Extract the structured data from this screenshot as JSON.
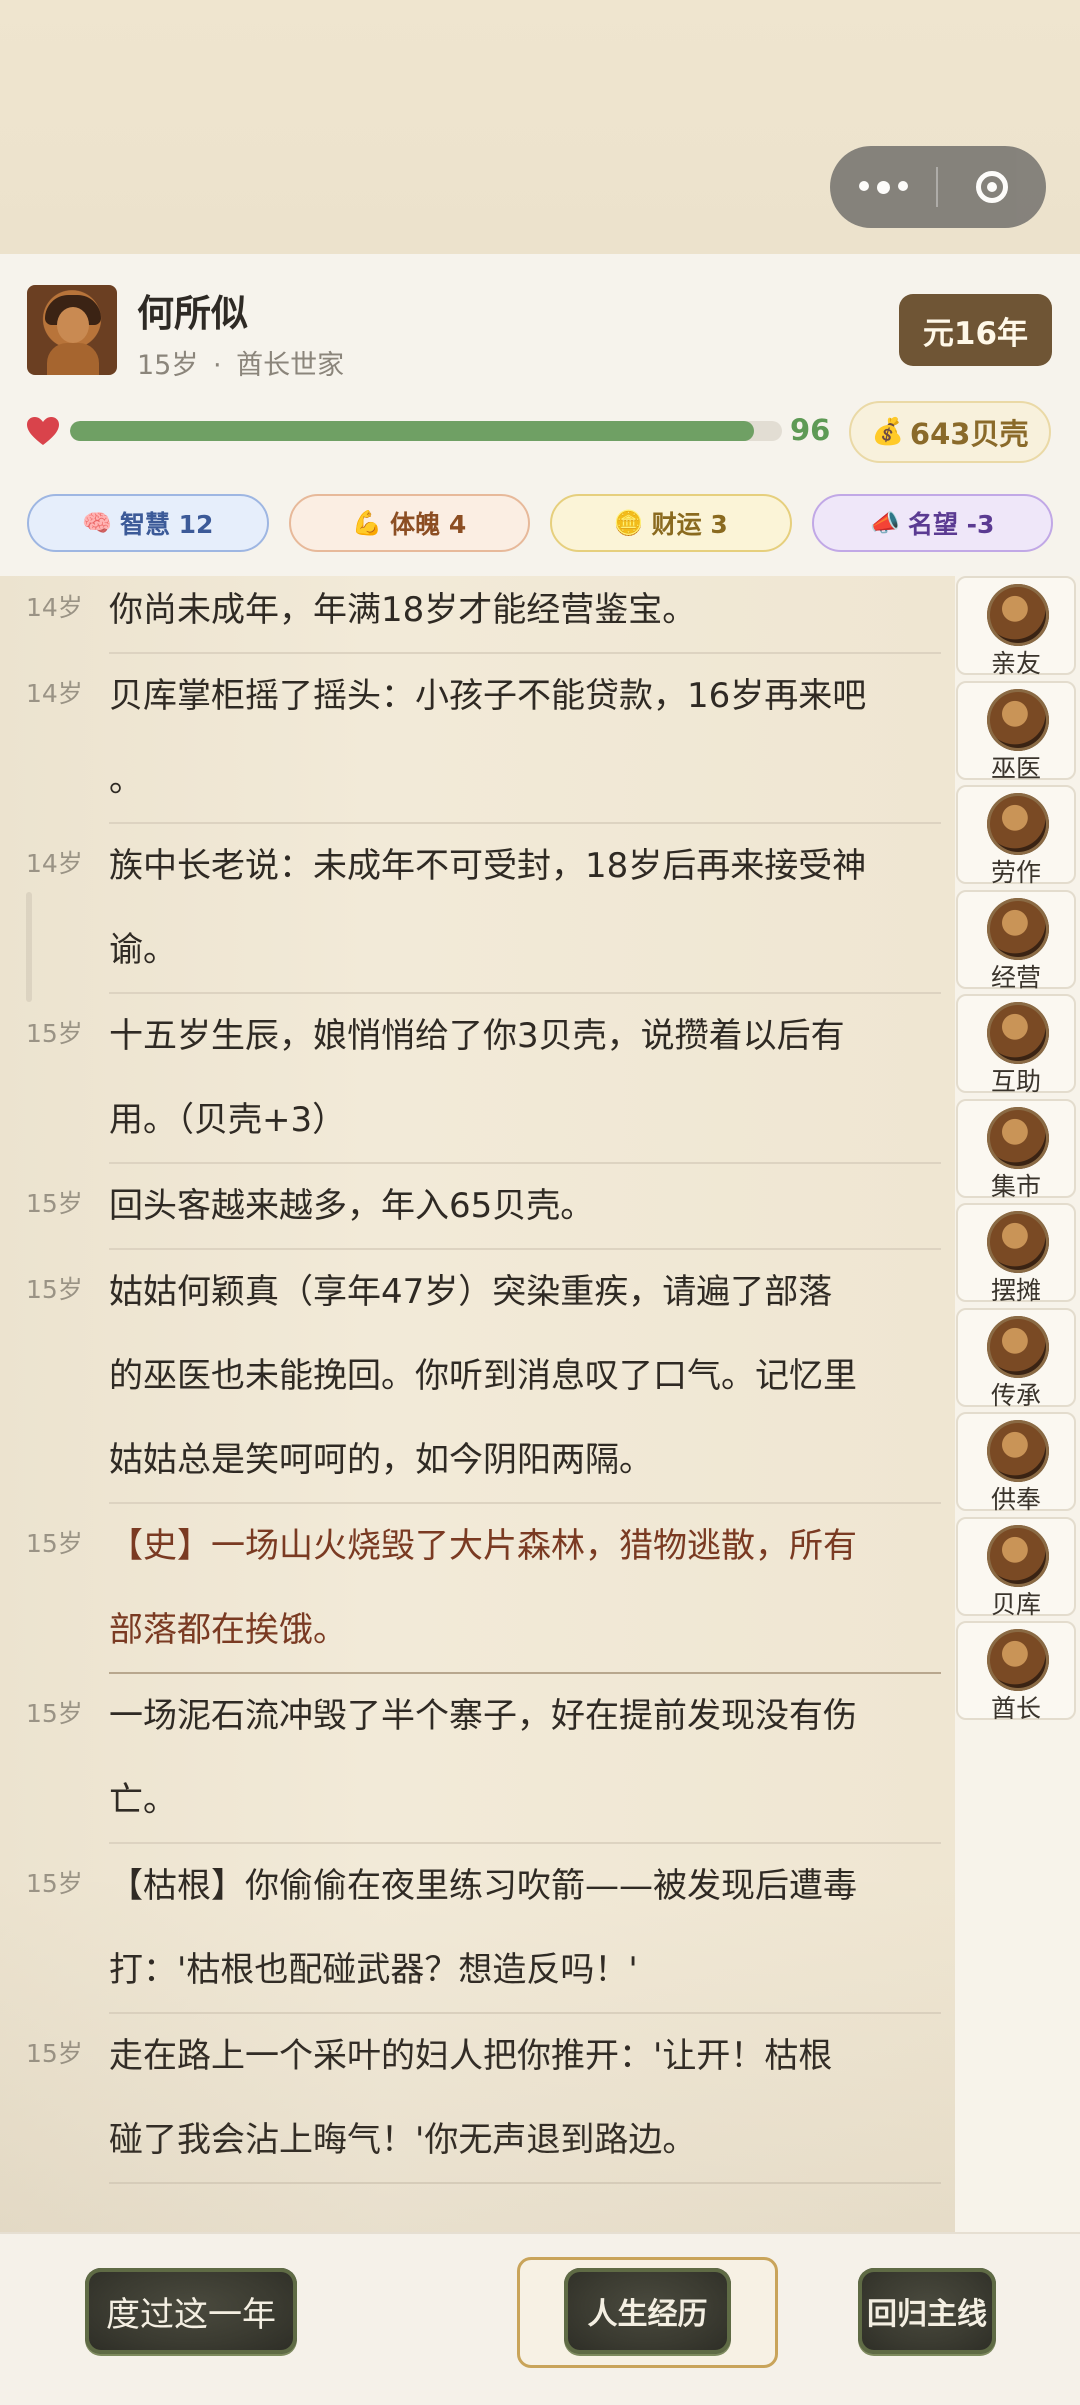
{
  "player": {
    "name": "何所似",
    "age_label": "15岁",
    "separator": "·",
    "family": "酋长世家",
    "year_badge": "元16年",
    "health": 96,
    "health_max": 100,
    "shells_icon": "money-bag-icon",
    "shells": "643贝壳"
  },
  "stats": [
    {
      "icon": "brain-icon",
      "label": "智慧 12"
    },
    {
      "icon": "muscle-icon",
      "label": "体魄 4"
    },
    {
      "icon": "gold-ingot-icon",
      "label": "财运 3"
    },
    {
      "icon": "megaphone-icon",
      "label": "名望 -3"
    }
  ],
  "log": [
    {
      "age": "14岁",
      "lines": [
        "你尚未成年，年满18岁才能经营鉴宝。"
      ],
      "type": "normal"
    },
    {
      "age": "14岁",
      "lines": [
        "贝库掌柜摇了摇头：小孩子不能贷款，16岁再来吧",
        "。"
      ],
      "type": "normal"
    },
    {
      "age": "14岁",
      "lines": [
        "族中长老说：未成年不可受封，18岁后再来接受神",
        "谕。"
      ],
      "type": "normal"
    },
    {
      "age": "15岁",
      "lines": [
        "十五岁生辰，娘悄悄给了你3贝壳，说攒着以后有",
        "用。（贝壳+3）"
      ],
      "type": "normal"
    },
    {
      "age": "15岁",
      "lines": [
        "回头客越来越多，年入65贝壳。"
      ],
      "type": "normal"
    },
    {
      "age": "15岁",
      "lines": [
        "姑姑何颖真（享年47岁）突染重疾，请遍了部落",
        "的巫医也未能挽回。你听到消息叹了口气。记忆里",
        "姑姑总是笑呵呵的，如今阴阳两隔。"
      ],
      "type": "normal"
    },
    {
      "age": "15岁",
      "lines": [
        "【史】一场山火烧毁了大片森林，猎物逃散，所有",
        "部落都在挨饿。"
      ],
      "type": "history"
    },
    {
      "age": "15岁",
      "lines": [
        "一场泥石流冲毁了半个寨子，好在提前发现没有伤",
        "亡。"
      ],
      "type": "normal"
    },
    {
      "age": "15岁",
      "lines": [
        "【枯根】你偷偷在夜里练习吹箭——被发现后遭毒",
        "打：'枯根也配碰武器？想造反吗！'"
      ],
      "type": "normal"
    },
    {
      "age": "15岁",
      "lines": [
        "走在路上一个采叶的妇人把你推开：'让开！枯根",
        "碰了我会沾上晦气！'你无声退到路边。"
      ],
      "type": "normal"
    }
  ],
  "rail": [
    {
      "label": "亲友",
      "icon": "family-icon"
    },
    {
      "label": "巫医",
      "icon": "shaman-icon"
    },
    {
      "label": "劳作",
      "icon": "tools-icon"
    },
    {
      "label": "经营",
      "icon": "hut-icon"
    },
    {
      "label": "互助",
      "icon": "handshake-icon"
    },
    {
      "label": "集市",
      "icon": "market-icon"
    },
    {
      "label": "摆摊",
      "icon": "stall-icon"
    },
    {
      "label": "传承",
      "icon": "elder-icon"
    },
    {
      "label": "供奉",
      "icon": "altar-icon"
    },
    {
      "label": "贝库",
      "icon": "treasury-icon"
    },
    {
      "label": "酋长",
      "icon": "chief-icon"
    }
  ],
  "actions": {
    "next_year": "度过这一年",
    "life_history": "人生经历",
    "back_main": "回归主线"
  }
}
